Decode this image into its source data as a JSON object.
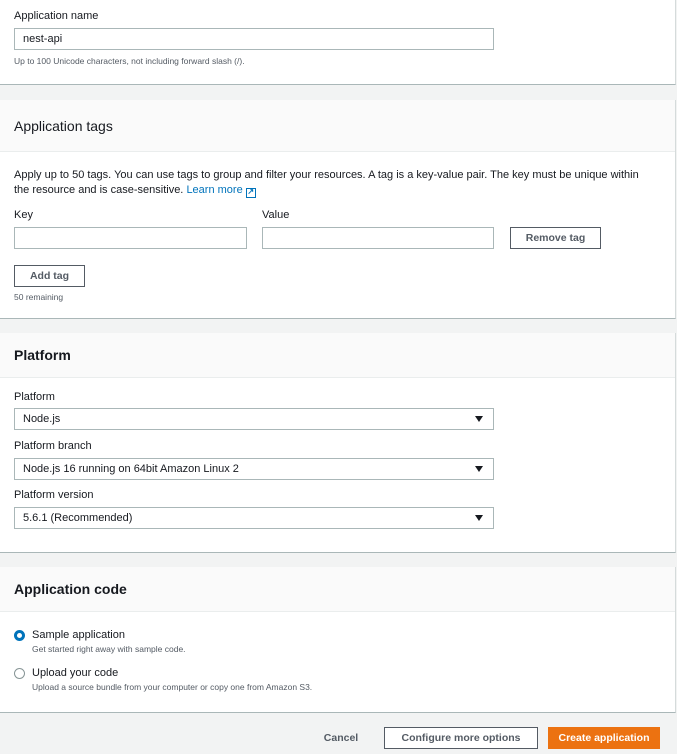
{
  "app_name": {
    "label": "Application name",
    "value": "nest-api",
    "hint": "Up to 100 Unicode characters, not including forward slash (/)."
  },
  "tags": {
    "title": "Application tags",
    "description": "Apply up to 50 tags. You can use tags to group and filter your resources. A tag is a key-value pair. The key must be unique within the resource and is case-sensitive.",
    "learn_more": "Learn more",
    "key_label": "Key",
    "value_label": "Value",
    "key_value": "",
    "value_value": "",
    "remove_tag": "Remove tag",
    "add_tag": "Add tag",
    "remaining": "50 remaining"
  },
  "platform": {
    "title": "Platform",
    "platform_label": "Platform",
    "platform_value": "Node.js",
    "branch_label": "Platform branch",
    "branch_value": "Node.js 16 running on 64bit Amazon Linux 2",
    "version_label": "Platform version",
    "version_value": "5.6.1 (Recommended)"
  },
  "code": {
    "title": "Application code",
    "options": [
      {
        "label": "Sample application",
        "desc": "Get started right away with sample code.",
        "selected": true
      },
      {
        "label": "Upload your code",
        "desc": "Upload a source bundle from your computer or copy one from Amazon S3.",
        "selected": false
      }
    ]
  },
  "footer": {
    "cancel": "Cancel",
    "configure": "Configure more options",
    "create": "Create application"
  },
  "colors": {
    "accent": "#0073bb",
    "primary": "#ec7211"
  }
}
